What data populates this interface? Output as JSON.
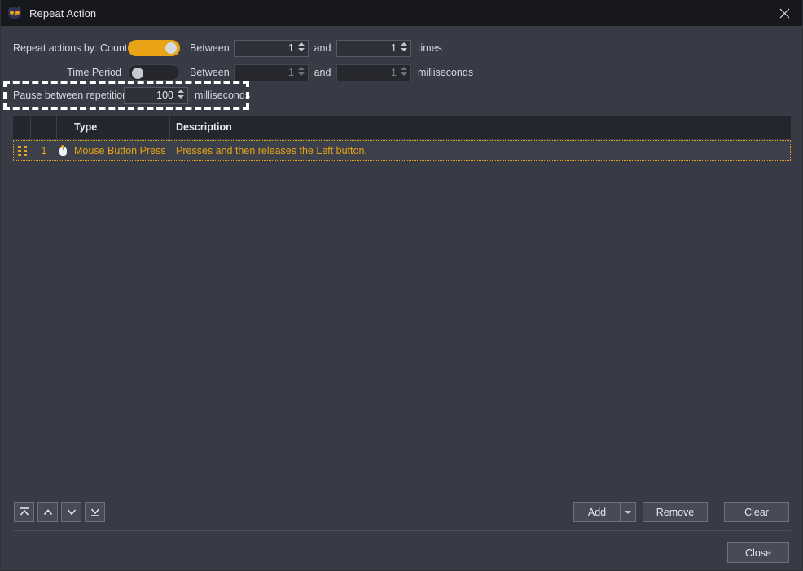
{
  "window": {
    "title": "Repeat Action",
    "app_icon": "owl-app-icon",
    "close_icon": "close-icon"
  },
  "options": {
    "count_row": {
      "label": "Repeat actions by: Count",
      "toggle_state": "on",
      "between_label": "Between",
      "min_value": "1",
      "and_label": "and",
      "max_value": "1",
      "unit": "times"
    },
    "time_row": {
      "label": "Time Period",
      "toggle_state": "off",
      "between_label": "Between",
      "min_value": "1",
      "and_label": "and",
      "max_value": "1",
      "unit": "milliseconds",
      "disabled": true
    },
    "pause_row": {
      "label": "Pause between repetitions",
      "value": "100",
      "unit": "milliseconds",
      "highlighted": true
    }
  },
  "table": {
    "headers": {
      "handle": "",
      "number": "",
      "icon": "",
      "type": "Type",
      "description": "Description"
    },
    "rows": [
      {
        "handle_icon": "drag-handle-icon",
        "number": "1",
        "row_icon": "mouse-icon",
        "type": "Mouse Button Press",
        "description": "Presses and then releases the Left button.",
        "selected": true
      }
    ]
  },
  "order_buttons": [
    {
      "name": "move-to-top-button",
      "icon": "move-to-top-icon"
    },
    {
      "name": "move-up-button",
      "icon": "chevron-up-icon"
    },
    {
      "name": "move-down-button",
      "icon": "chevron-down-icon"
    },
    {
      "name": "move-to-bottom-button",
      "icon": "move-to-bottom-icon"
    }
  ],
  "action_buttons": {
    "add": "Add",
    "add_dropdown_icon": "chevron-down-icon",
    "remove": "Remove",
    "clear": "Clear"
  },
  "footer": {
    "close": "Close"
  },
  "colors": {
    "accent": "#e8a317",
    "window_bg": "#383b45",
    "titlebar_bg": "#17181c",
    "header_bg": "#24262d",
    "button_bg": "#474b56",
    "highlight_outline": "#ffffff"
  }
}
